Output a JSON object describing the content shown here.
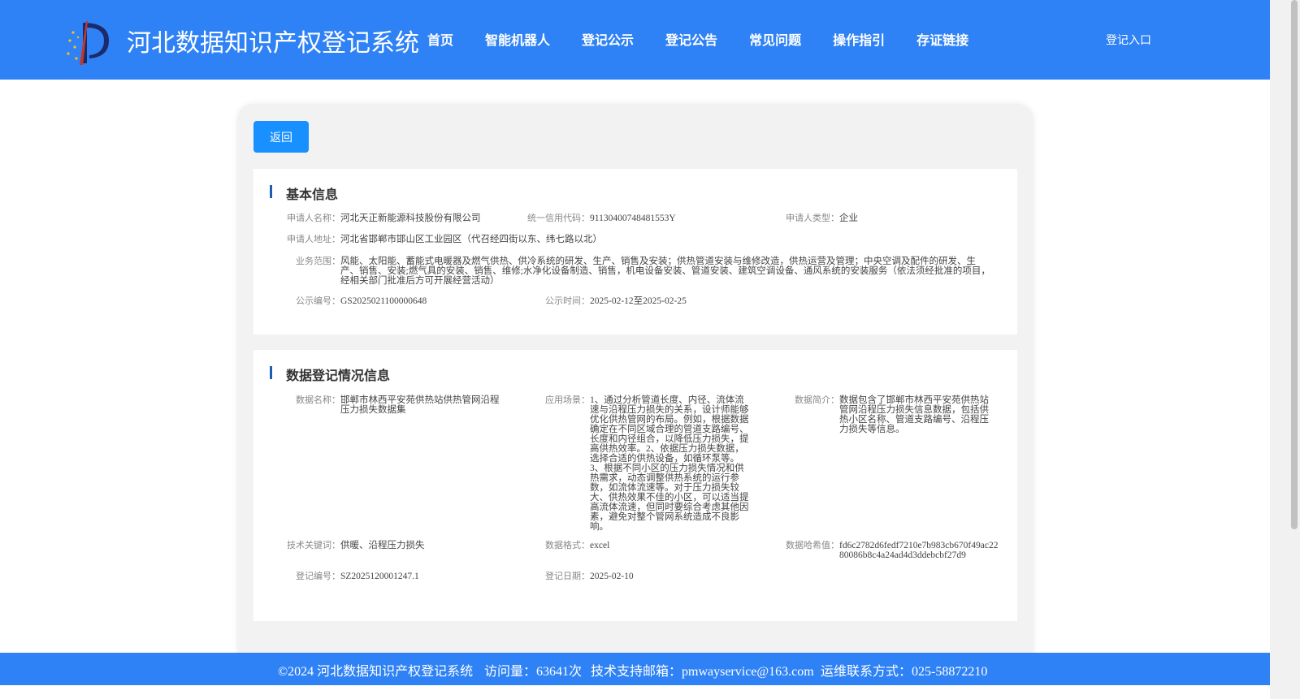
{
  "header": {
    "title": "河北数据知识产权登记系统",
    "nav": [
      "首页",
      "智能机器人",
      "登记公示",
      "登记公告",
      "常见问题",
      "操作指引",
      "存证链接"
    ],
    "login": "登记入口"
  },
  "back_label": "返回",
  "basic": {
    "title": "基本信息",
    "applicant_name_label": "申请人名称：",
    "applicant_name": "河北天正新能源科技股份有限公司",
    "credit_code_label": "统一信用代码：",
    "credit_code": "91130400748481553Y",
    "applicant_type_label": "申请人类型：",
    "applicant_type": "企业",
    "address_label": "申请人地址：",
    "address": "河北省邯郸市邯山区工业园区（代召经四街以东、纬七路以北）",
    "scope_label": "业务范围：",
    "scope": "风能、太阳能、蓄能式电暖器及燃气供热、供冷系统的研发、生产、销售及安装；供热管道安装与维修改造，供热运营及管理；中央空调及配件的研发、生产、销售、安装;燃气具的安装、销售、维修;水净化设备制造、销售，机电设备安装、管道安装、建筑空调设备、通风系统的安装服务（依法须经批准的项目，经相关部门批准后方可开展经营活动）",
    "pub_no_label": "公示编号：",
    "pub_no": "GS2025021100000648",
    "pub_time_label": "公示时间：",
    "pub_time": "2025-02-12至2025-02-25"
  },
  "data_reg": {
    "title": "数据登记情况信息",
    "name_label": "数据名称：",
    "name": "邯郸市林西平安苑供热站供热管网沿程压力损失数据集",
    "scene_label": "应用场景：",
    "scene": "1、通过分析管道长度、内径、流体流速与沿程压力损失的关系，设计师能够优化供热管网的布局。例如，根据数据确定在不同区域合理的管道支路编号、长度和内径组合，以降低压力损失，提高供热效率。2、依据压力损失数据，选择合适的供热设备，如循环泵等。3、根据不同小区的压力损失情况和供热需求，动态调整供热系统的运行参数，如流体流速等。对于压力损失较大、供热效果不佳的小区，可以适当提高流体流速，但同时要综合考虑其他因素，避免对整个管网系统造成不良影响。",
    "summary_label": "数据简介：",
    "summary": "数据包含了邯郸市林西平安苑供热站管网沿程压力损失信息数据，包括供热小区名称、管道支路编号、沿程压力损失等信息。",
    "keywords_label": "技术关键词：",
    "keywords": "供暖、沿程压力损失",
    "format_label": "数据格式：",
    "format": "excel",
    "hash_label": "数据哈希值：",
    "hash": "fd6c2782d6fedf7210e7b983cb670f49ac2280086b8c4a24ad4d3ddebcbf27d9",
    "reg_no_label": "登记编号：",
    "reg_no": "SZ2025120001247.1",
    "reg_date_label": "登记日期：",
    "reg_date": "2025-02-10"
  },
  "footer": {
    "copyright": "©2024 河北数据知识产权登记系统",
    "visits": "访问量：63641次",
    "email": "技术支持邮箱：pmwayservice@163.com",
    "phone": "运维联系方式：025-58872210"
  },
  "colors": {
    "primary": "#2f82f5",
    "button": "#1890ff",
    "accent": "#1a5fb4"
  }
}
